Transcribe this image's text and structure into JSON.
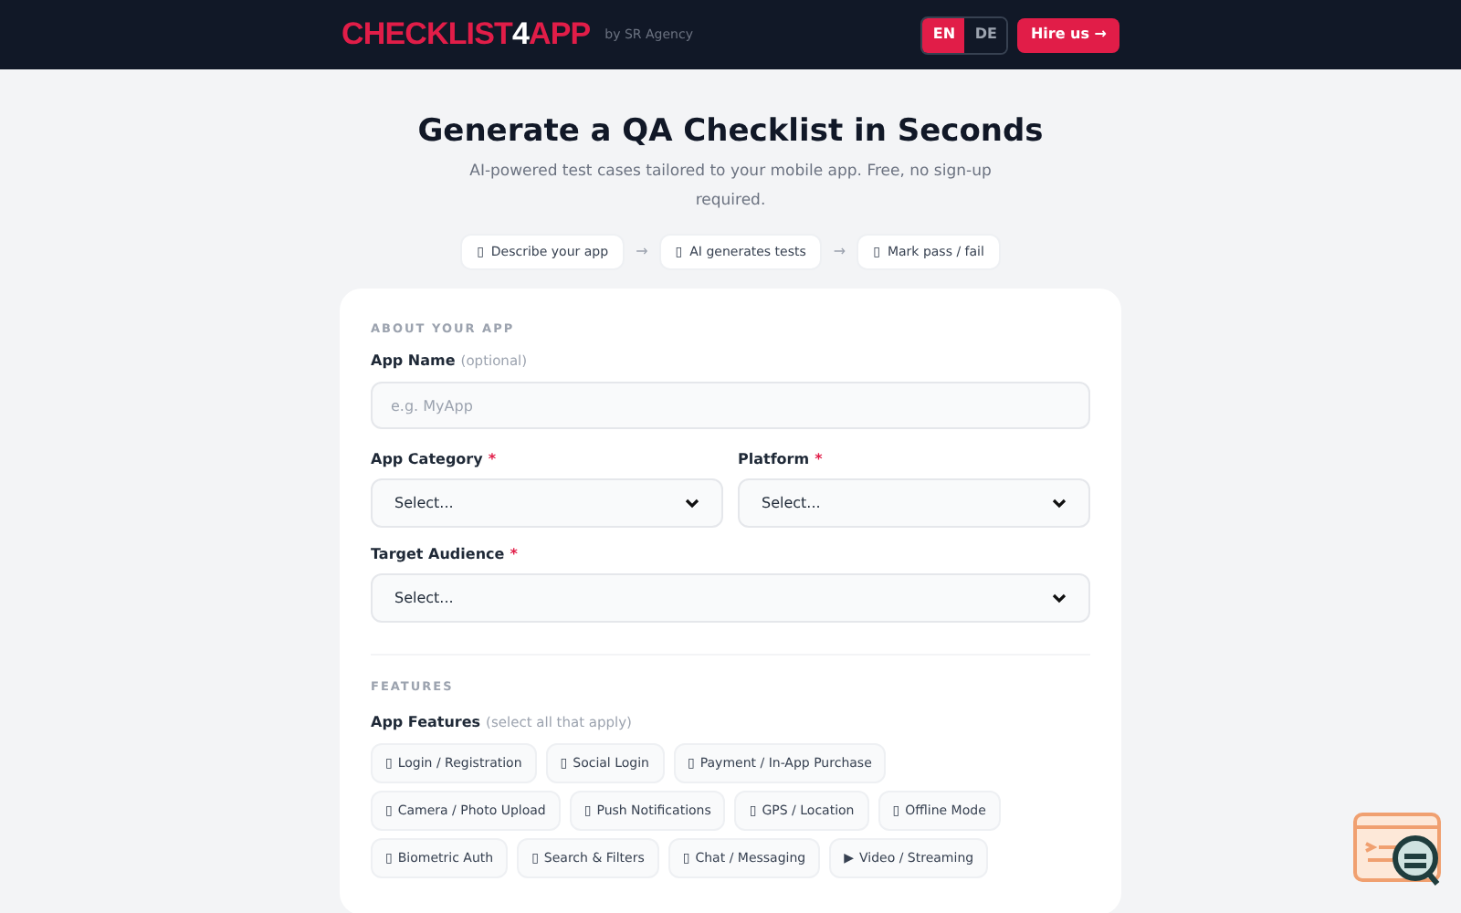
{
  "header": {
    "logo_prefix": "CHECKLIST",
    "logo_digit": "4",
    "logo_suffix": "APP",
    "byline": "by SR Agency",
    "languages": [
      {
        "label": "EN",
        "selected": true
      },
      {
        "label": "DE",
        "selected": false
      }
    ],
    "hire_button": "Hire us →"
  },
  "hero": {
    "title": "Generate a QA Checklist in Seconds",
    "subtitle": "AI-powered test cases tailored to your mobile app. Free, no sign-up required.",
    "steps": [
      {
        "icon": "▯",
        "label": "Describe your app"
      },
      {
        "icon": "▯",
        "label": "AI generates tests"
      },
      {
        "icon": "▯",
        "label": "Mark pass / fail"
      }
    ],
    "step_separator": "→"
  },
  "about": {
    "heading": "ABOUT YOUR APP",
    "app_name": {
      "label": "App Name",
      "hint": "(optional)",
      "placeholder": "e.g. MyApp"
    },
    "selects": [
      {
        "label": "App Category",
        "required_mark": "*",
        "value": "Select..."
      },
      {
        "label": "Platform",
        "required_mark": "*",
        "value": "Select..."
      },
      {
        "label": "Target Audience",
        "required_mark": "*",
        "value": "Select..."
      }
    ]
  },
  "features": {
    "heading": "FEATURES",
    "label": "App Features",
    "hint": "(select all that apply)",
    "options": [
      {
        "icon": "▯",
        "label": "Login / Registration",
        "selected": false
      },
      {
        "icon": "▯",
        "label": "Social Login",
        "selected": false
      },
      {
        "icon": "▯",
        "label": "Payment / In-App Purchase",
        "selected": false
      },
      {
        "icon": "▯",
        "label": "Camera / Photo Upload",
        "selected": false
      },
      {
        "icon": "▯",
        "label": "Push Notifications",
        "selected": false
      },
      {
        "icon": "▯",
        "label": "GPS / Location",
        "selected": false
      },
      {
        "icon": "▯",
        "label": "Offline Mode",
        "selected": false
      },
      {
        "icon": "▯",
        "label": "Biometric Auth",
        "selected": false
      },
      {
        "icon": "▯",
        "label": "Search & Filters",
        "selected": false
      },
      {
        "icon": "▯",
        "label": "Chat / Messaging",
        "selected": false
      },
      {
        "icon": "▶",
        "label": "Video / Streaming",
        "selected": false
      }
    ]
  }
}
